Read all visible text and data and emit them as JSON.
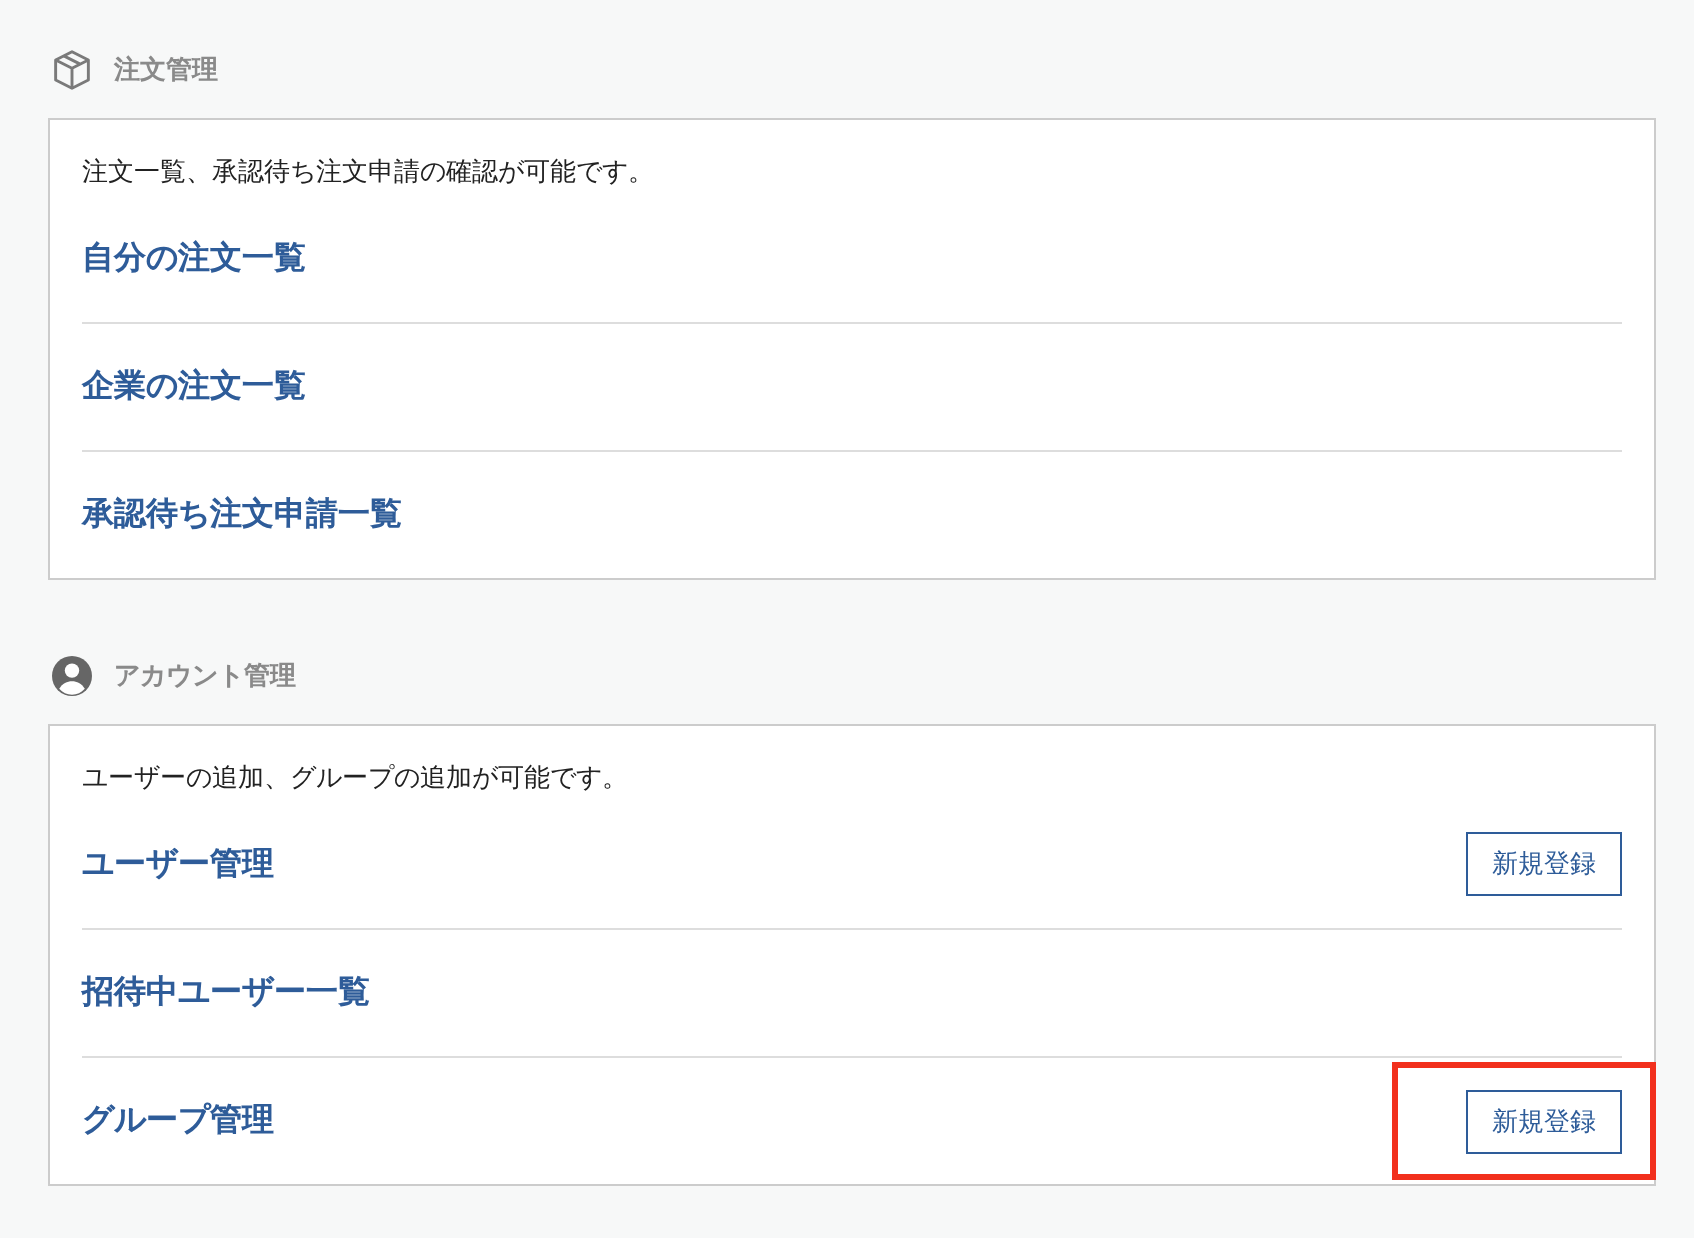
{
  "sections": [
    {
      "kind": "orders",
      "title": "注文管理",
      "description": "注文一覧、承認待ち注文申請の確認が可能です。",
      "links": [
        {
          "label": "自分の注文一覧"
        },
        {
          "label": "企業の注文一覧"
        },
        {
          "label": "承認待ち注文申請一覧"
        }
      ]
    },
    {
      "kind": "accounts",
      "title": "アカウント管理",
      "description": "ユーザーの追加、グループの追加が可能です。",
      "links": [
        {
          "label": "ユーザー管理",
          "button": {
            "label": "新規登録",
            "highlighted": false
          }
        },
        {
          "label": "招待中ユーザー一覧"
        },
        {
          "label": "グループ管理",
          "button": {
            "label": "新規登録",
            "highlighted": true
          }
        }
      ]
    }
  ]
}
